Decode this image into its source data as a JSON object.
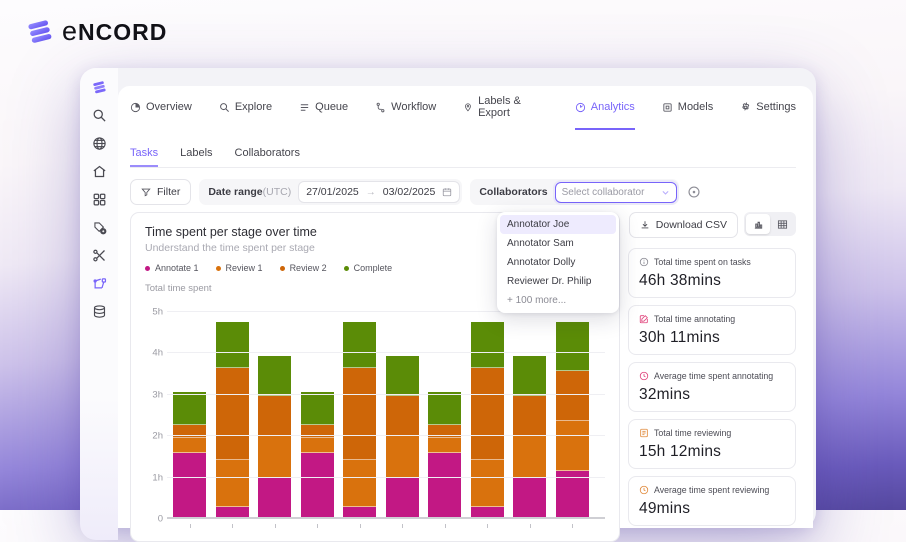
{
  "brand": {
    "name": "encord",
    "logo_icon": "encord-logo-icon"
  },
  "colors": {
    "accent": "#7864FA",
    "annotate": "#C21884",
    "review1": "#D9720D",
    "review2": "#CE6608",
    "complete": "#5B8C07",
    "stat_pink": "#E0447C",
    "stat_orange": "#E08A3C",
    "stat_gray": "#8a8a93"
  },
  "sidebar": {
    "icons": [
      "encord-logo-icon",
      "search-icon",
      "globe-icon",
      "home-icon",
      "apps-grid-icon",
      "tag-add-icon",
      "automation-scissors-icon",
      "polygon-annotate-icon",
      "dataset-icon"
    ]
  },
  "nav": {
    "tabs": [
      {
        "label": "Overview",
        "icon": "pie-icon",
        "active": false
      },
      {
        "label": "Explore",
        "icon": "search-icon",
        "active": false
      },
      {
        "label": "Queue",
        "icon": "list-icon",
        "active": false
      },
      {
        "label": "Workflow",
        "icon": "branch-icon",
        "active": false
      },
      {
        "label": "Labels & Export",
        "icon": "tag-icon",
        "active": false
      },
      {
        "label": "Analytics",
        "icon": "gauge-icon",
        "active": true
      },
      {
        "label": "Models",
        "icon": "model-icon",
        "active": false
      },
      {
        "label": "Settings",
        "icon": "gear-icon",
        "active": false
      }
    ]
  },
  "subtabs": [
    {
      "label": "Tasks",
      "active": true
    },
    {
      "label": "Labels",
      "active": false
    },
    {
      "label": "Collaborators",
      "active": false
    }
  ],
  "filters": {
    "filter_button": "Filter",
    "filter_icon": "funnel-icon",
    "date_range_label": "Date range",
    "date_range_suffix": "(UTC)",
    "date_from": "27/01/2025",
    "date_arrow": "→",
    "date_to": "03/02/2025",
    "calendar_icon": "calendar-icon",
    "collaborators_label": "Collaborators",
    "select_placeholder": "Select collaborator",
    "chevron_icon": "chevron-down-icon",
    "reset_icon": "circle-dot-icon"
  },
  "dropdown": {
    "options": [
      {
        "label": "Annotator Joe",
        "selected": true
      },
      {
        "label": "Annotator Sam",
        "selected": false
      },
      {
        "label": "Annotator Dolly",
        "selected": false
      },
      {
        "label": "Reviewer Dr. Philip",
        "selected": false
      },
      {
        "label": "+ 100 more...",
        "selected": false
      }
    ]
  },
  "toolbar": {
    "download_label": "Download CSV",
    "download_icon": "download-icon",
    "view_toggle": [
      {
        "icon": "bar-chart-icon",
        "active": true
      },
      {
        "icon": "table-grid-icon",
        "active": false
      }
    ]
  },
  "chart_data": {
    "type": "bar",
    "stacked": true,
    "title": "Time spent per stage over time",
    "subtitle": "Understand the time spent per stage",
    "ylabel": "Total time spent",
    "unit": "hours",
    "ylim": [
      0,
      5
    ],
    "yticks": [
      "0",
      "1h",
      "2h",
      "3h",
      "4h",
      "5h"
    ],
    "grid": true,
    "x_count": 10,
    "x_labels_visible": false,
    "legend_position": "top",
    "series": [
      {
        "name": "Annotate 1",
        "color": "#C21884",
        "values": [
          1.6,
          0.3,
          1.0,
          1.6,
          0.3,
          1.0,
          1.6,
          0.3,
          1.0,
          1.17
        ]
      },
      {
        "name": "Review 1",
        "color": "#D9720D",
        "values": [
          0.35,
          1.13,
          1.0,
          0.35,
          1.13,
          1.0,
          0.35,
          1.13,
          1.0,
          1.2
        ]
      },
      {
        "name": "Review 2",
        "color": "#CE6608",
        "values": [
          0.33,
          2.22,
          0.97,
          0.33,
          2.22,
          0.97,
          0.33,
          2.22,
          0.97,
          1.2
        ]
      },
      {
        "name": "Complete",
        "color": "#5B8C07",
        "values": [
          0.79,
          1.1,
          0.98,
          0.79,
          1.1,
          0.98,
          0.79,
          1.1,
          0.98,
          1.2
        ]
      }
    ]
  },
  "stats": {
    "cards": [
      {
        "icon": "info-circle-icon",
        "color": "#8a8a93",
        "label": "Total time spent on tasks",
        "value": "46h 38mins"
      },
      {
        "icon": "edit-square-icon",
        "color": "#E0447C",
        "label": "Total time annotating",
        "value": "30h 11mins"
      },
      {
        "icon": "clock-icon",
        "color": "#E0447C",
        "label": "Average time spent annotating",
        "value": "32mins"
      },
      {
        "icon": "review-doc-icon",
        "color": "#E08A3C",
        "label": "Total time reviewing",
        "value": "15h 12mins"
      },
      {
        "icon": "clock-icon",
        "color": "#E08A3C",
        "label": "Average time spent reviewing",
        "value": "49mins"
      }
    ]
  }
}
